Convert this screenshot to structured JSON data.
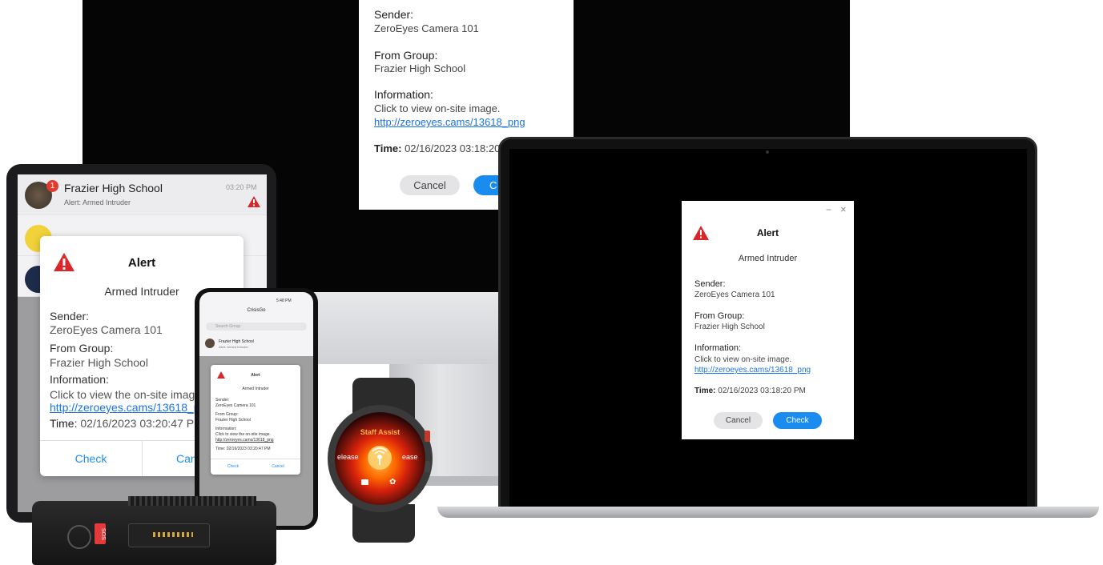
{
  "monitor_dialog": {
    "sender_label": "Sender:",
    "sender_value": "ZeroEyes Camera 101",
    "group_label": "From Group:",
    "group_value": "Frazier High School",
    "info_label": "Information:",
    "info_text": "Click to view on-site image.",
    "info_link": "http://zeroeyes.cams/13618_png",
    "time_label": "Time:",
    "time_value": "02/16/2023 03:18:20",
    "cancel_label": "Cancel",
    "check_label": "C"
  },
  "tablet": {
    "chat_title": "Frazier High School",
    "chat_time": "03:20 PM",
    "chat_preview": "Alert: Armed Intruder",
    "badge_count": "1",
    "dialog": {
      "title": "Alert",
      "subtitle": "Armed Intruder",
      "sender_label": "Sender:",
      "sender_value": "ZeroEyes Camera 101",
      "group_label": "From Group:",
      "group_value": "Frazier High School",
      "info_label": "Information:",
      "info_text": "Click to view the on-site image",
      "info_link": "http://zeroeyes.cams/13618_pn",
      "time_label": "Time:",
      "time_value": "02/16/2023 03:20:47 PM",
      "check_label": "Check",
      "cancel_label": "Can"
    }
  },
  "phone": {
    "status": "5:48 PM",
    "app_title": "CrisisGo",
    "search_placeholder": "Search Group",
    "chat_title": "Frazier High School",
    "chat_preview": "Alert: Armed Intruder",
    "dialog": {
      "title": "Alert",
      "subtitle": "Armed Intruder",
      "sender_label": "Sender:",
      "sender_value": "ZeroEyes Camera 101",
      "group_label": "From Group:",
      "group_value": "Frazier High School",
      "info_label": "Information:",
      "info_text": "Click to view the on-site image.",
      "info_link": "http://zeroeyes.cams/13618_png",
      "time_label": "Time:",
      "time_value": "02/16/2023 03:20:47 PM",
      "check_label": "Check",
      "cancel_label": "Cancel"
    }
  },
  "watch": {
    "title": "Staff Assist",
    "left_text": "elease",
    "right_text": "ease"
  },
  "radio": {
    "sos_label": "SOS"
  },
  "laptop_dialog": {
    "title": "Alert",
    "subtitle": "Armed Intruder",
    "sender_label": "Sender:",
    "sender_value": "ZeroEyes Camera 101",
    "group_label": "From Group:",
    "group_value": "Frazier High School",
    "info_label": "Information:",
    "info_text": "Click to view on-site image.",
    "info_link": "http://zeroeyes.cams/13618_png",
    "time_label": "Time:",
    "time_value": "02/16/2023 03:18:20 PM",
    "cancel_label": "Cancel",
    "check_label": "Check",
    "minimize_icon": "−",
    "close_icon": "×"
  },
  "colors": {
    "accent": "#1a8cf0",
    "alert_red": "#d9262b",
    "link": "#1a73e8"
  }
}
